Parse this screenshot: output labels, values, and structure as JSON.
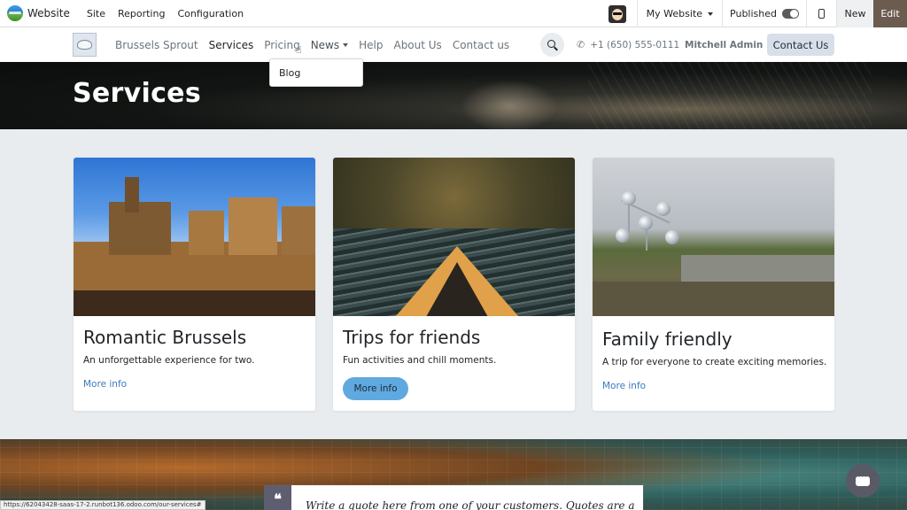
{
  "admin_bar": {
    "brand": "Website",
    "menus": [
      "Site",
      "Reporting",
      "Configuration"
    ],
    "website_selector": "My Website",
    "published_label": "Published",
    "new_label": "New",
    "edit_label": "Edit"
  },
  "navbar": {
    "links": [
      {
        "label": "Brussels Sprout"
      },
      {
        "label": "Services"
      },
      {
        "label": "Pricing"
      },
      {
        "label": "News"
      },
      {
        "label": "Help"
      },
      {
        "label": "About Us"
      },
      {
        "label": "Contact us"
      }
    ],
    "active_link": "Services",
    "phone": "+1 (650) 555-0111",
    "user": "Mitchell Admin",
    "cta": "Contact Us"
  },
  "dropdown": {
    "items": [
      "Blog"
    ]
  },
  "hero": {
    "title": "Services"
  },
  "cards": [
    {
      "title": "Romantic Brussels",
      "text": "An unforgettable experience for two.",
      "link": "More info"
    },
    {
      "title": "Trips for friends",
      "text": "Fun activities and chill moments.",
      "link": "More info"
    },
    {
      "title": "Family friendly",
      "text": "A trip for everyone to create exciting memories.",
      "link": "More info"
    }
  ],
  "quote": {
    "text": "Write a quote here from one of your customers. Quotes are a"
  },
  "status_bar": {
    "url": "https://62043428-saas-17-2.runbot136.odoo.com/our-services#"
  },
  "icons": {
    "search": "search-icon",
    "phone": "phone-icon",
    "chat": "chat-icon",
    "quote": "quote-icon",
    "mobile_preview": "mobile-icon"
  },
  "colors": {
    "edit_button": "#6b5c4f",
    "link": "#3a7bbf",
    "pill_button": "#5fa9e0",
    "contact_button": "#d8dfe8"
  }
}
